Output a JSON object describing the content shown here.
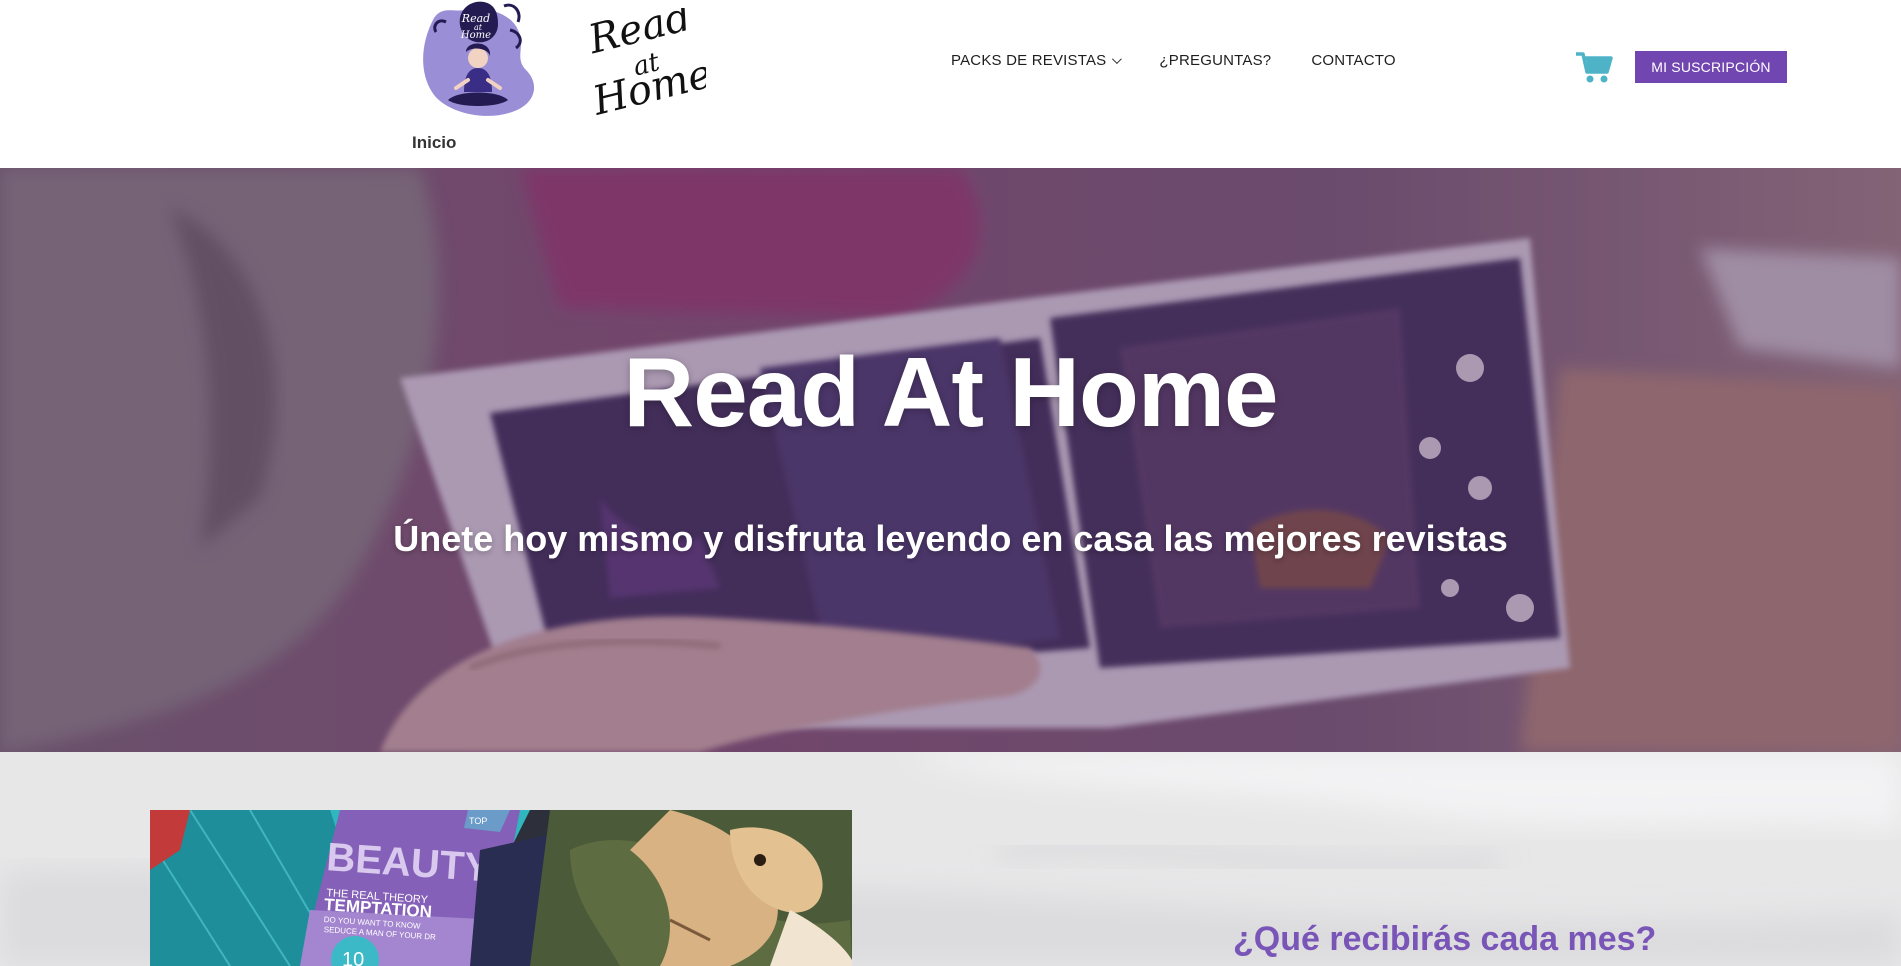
{
  "brand": {
    "logo_icon": "woman-reading-logo-icon",
    "wordmark": [
      "Read",
      "at",
      "Home"
    ],
    "badge_text": [
      "Read",
      "at",
      "Home"
    ]
  },
  "nav": {
    "items": [
      {
        "label": "PACKS DE REVISTAS",
        "has_dropdown": true
      },
      {
        "label": "¿PREGUNTAS?",
        "has_dropdown": false
      },
      {
        "label": "CONTACTO",
        "has_dropdown": false
      }
    ],
    "cart_icon": "shopping-cart-icon",
    "cta_label": "MI SUSCRIPCIÓN"
  },
  "breadcrumb": {
    "current": "Inicio"
  },
  "hero": {
    "title": "Read At Home",
    "subtitle": "Únete hoy mismo y disfruta leyendo en casa las mejores revistas"
  },
  "section": {
    "heading": "¿Qué recibirás cada mes?",
    "image_text": {
      "main": "BEAUTY&S",
      "line1": "THE REAL THEORY",
      "line2": "TEMPTATION",
      "line3": "DO YOU WANT TO KNOW",
      "line4": "SEDUCE A MAN OF YOUR DR",
      "badge": "10",
      "tag": "TOP"
    }
  },
  "colors": {
    "accent_purple": "#7146b0",
    "heading_purple": "#7a55b8",
    "cart_teal": "#4fb3c8",
    "hero_overlay": "#50285f"
  }
}
